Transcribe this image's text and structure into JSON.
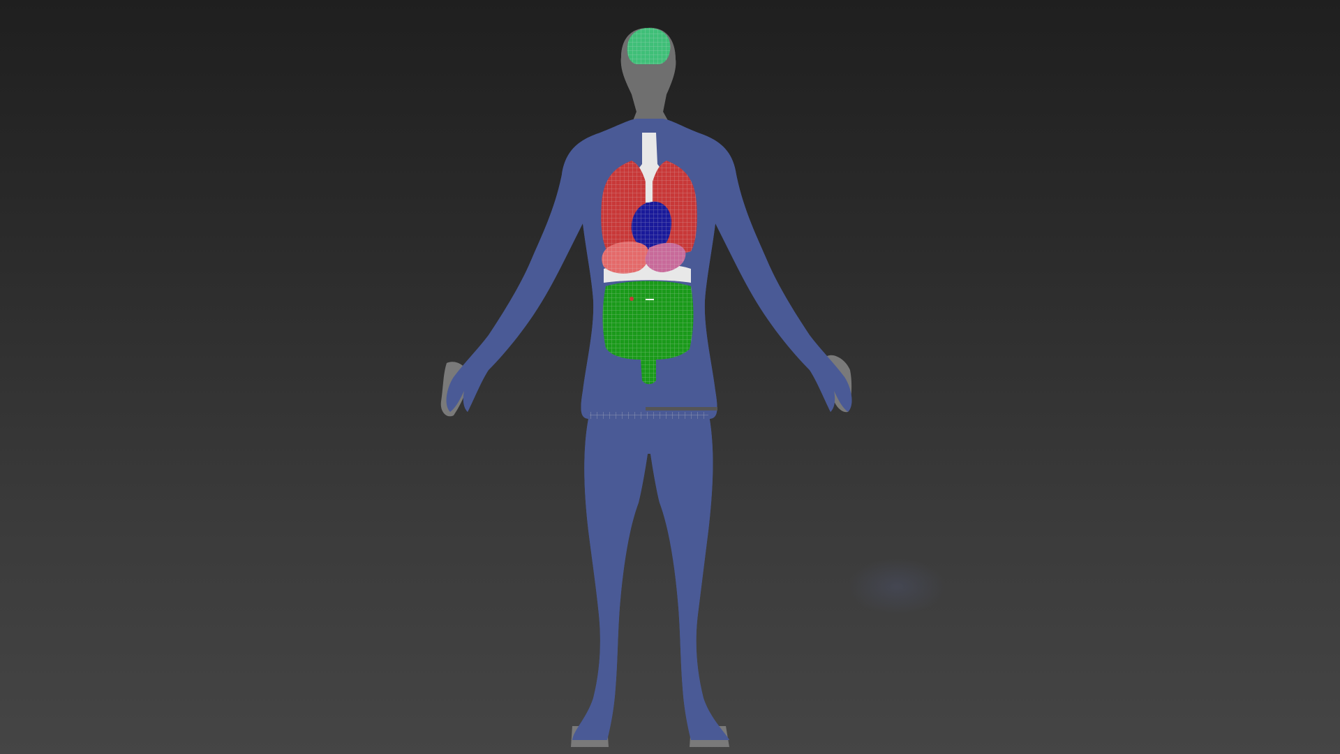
{
  "viewport": {
    "background_top": "#1f1f1f",
    "background_bottom": "#454545"
  },
  "model": {
    "body_color": "#4a5a96",
    "wire_color": "#b8b8b8",
    "organs": [
      {
        "name": "brain",
        "color": "#3fbf78"
      },
      {
        "name": "trachea",
        "color": "#e8e8e8"
      },
      {
        "name": "lungs",
        "color": "#c83838"
      },
      {
        "name": "heart",
        "color": "#1a1a9a"
      },
      {
        "name": "liver",
        "color": "#e46a6a"
      },
      {
        "name": "stomach",
        "color": "#c86a9a"
      },
      {
        "name": "diaphragm",
        "color": "#e8e8e8"
      },
      {
        "name": "intestines",
        "color": "#1a9a1a"
      }
    ]
  }
}
